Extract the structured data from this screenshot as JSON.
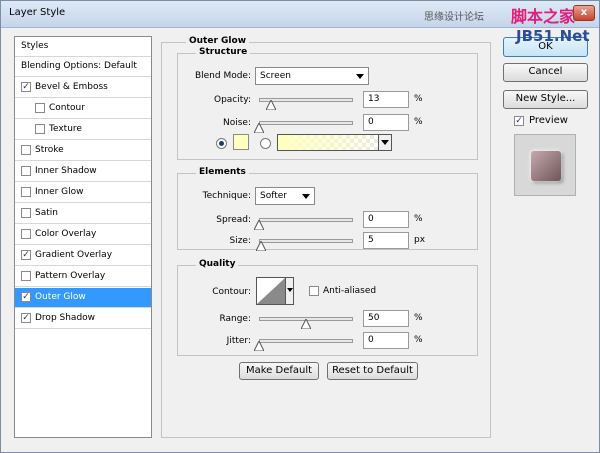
{
  "window": {
    "title": "Layer Style",
    "close_label": "x"
  },
  "watermark": {
    "cn_text": "思缘设计论坛",
    "big_text": "脚本之家",
    "site_text": "JB51.Net"
  },
  "styles_list": {
    "header": "Styles",
    "blending_options": "Blending Options: Default",
    "items": [
      {
        "label": "Bevel & Emboss",
        "checked": "✓",
        "indent": false
      },
      {
        "label": "Contour",
        "checked": "",
        "indent": true
      },
      {
        "label": "Texture",
        "checked": "",
        "indent": true
      },
      {
        "label": "Stroke",
        "checked": "",
        "indent": false
      },
      {
        "label": "Inner Shadow",
        "checked": "",
        "indent": false
      },
      {
        "label": "Inner Glow",
        "checked": "",
        "indent": false
      },
      {
        "label": "Satin",
        "checked": "",
        "indent": false
      },
      {
        "label": "Color Overlay",
        "checked": "",
        "indent": false
      },
      {
        "label": "Gradient Overlay",
        "checked": "✓",
        "indent": false
      },
      {
        "label": "Pattern Overlay",
        "checked": "",
        "indent": false
      },
      {
        "label": "Outer Glow",
        "checked": "✓",
        "indent": false,
        "selected": true
      },
      {
        "label": "Drop Shadow",
        "checked": "✓",
        "indent": false
      }
    ]
  },
  "outer_glow": {
    "title": "Outer Glow",
    "structure": {
      "title": "Structure",
      "blend_mode_label": "Blend Mode:",
      "blend_mode_value": "Screen",
      "opacity_label": "Opacity:",
      "opacity_value": "13",
      "opacity_unit": "%",
      "opacity_level": 0.13,
      "noise_label": "Noise:",
      "noise_value": "0",
      "noise_unit": "%",
      "noise_level": 0.0,
      "color_swatch": "#ffffc0"
    },
    "elements": {
      "title": "Elements",
      "technique_label": "Technique:",
      "technique_value": "Softer",
      "spread_label": "Spread:",
      "spread_value": "0",
      "spread_unit": "%",
      "spread_level": 0.0,
      "size_label": "Size:",
      "size_value": "5",
      "size_unit": "px",
      "size_level": 0.02
    },
    "quality": {
      "title": "Quality",
      "contour_label": "Contour:",
      "anti_aliased_label": "Anti-aliased",
      "range_label": "Range:",
      "range_value": "50",
      "range_unit": "%",
      "range_level": 0.5,
      "jitter_label": "Jitter:",
      "jitter_value": "0",
      "jitter_unit": "%",
      "jitter_level": 0.0
    },
    "make_default_label": "Make Default",
    "reset_default_label": "Reset to Default"
  },
  "side_buttons": {
    "ok_label": "OK",
    "cancel_label": "Cancel",
    "new_style_label": "New Style...",
    "preview_label": "Preview",
    "preview_checked": "✓"
  }
}
